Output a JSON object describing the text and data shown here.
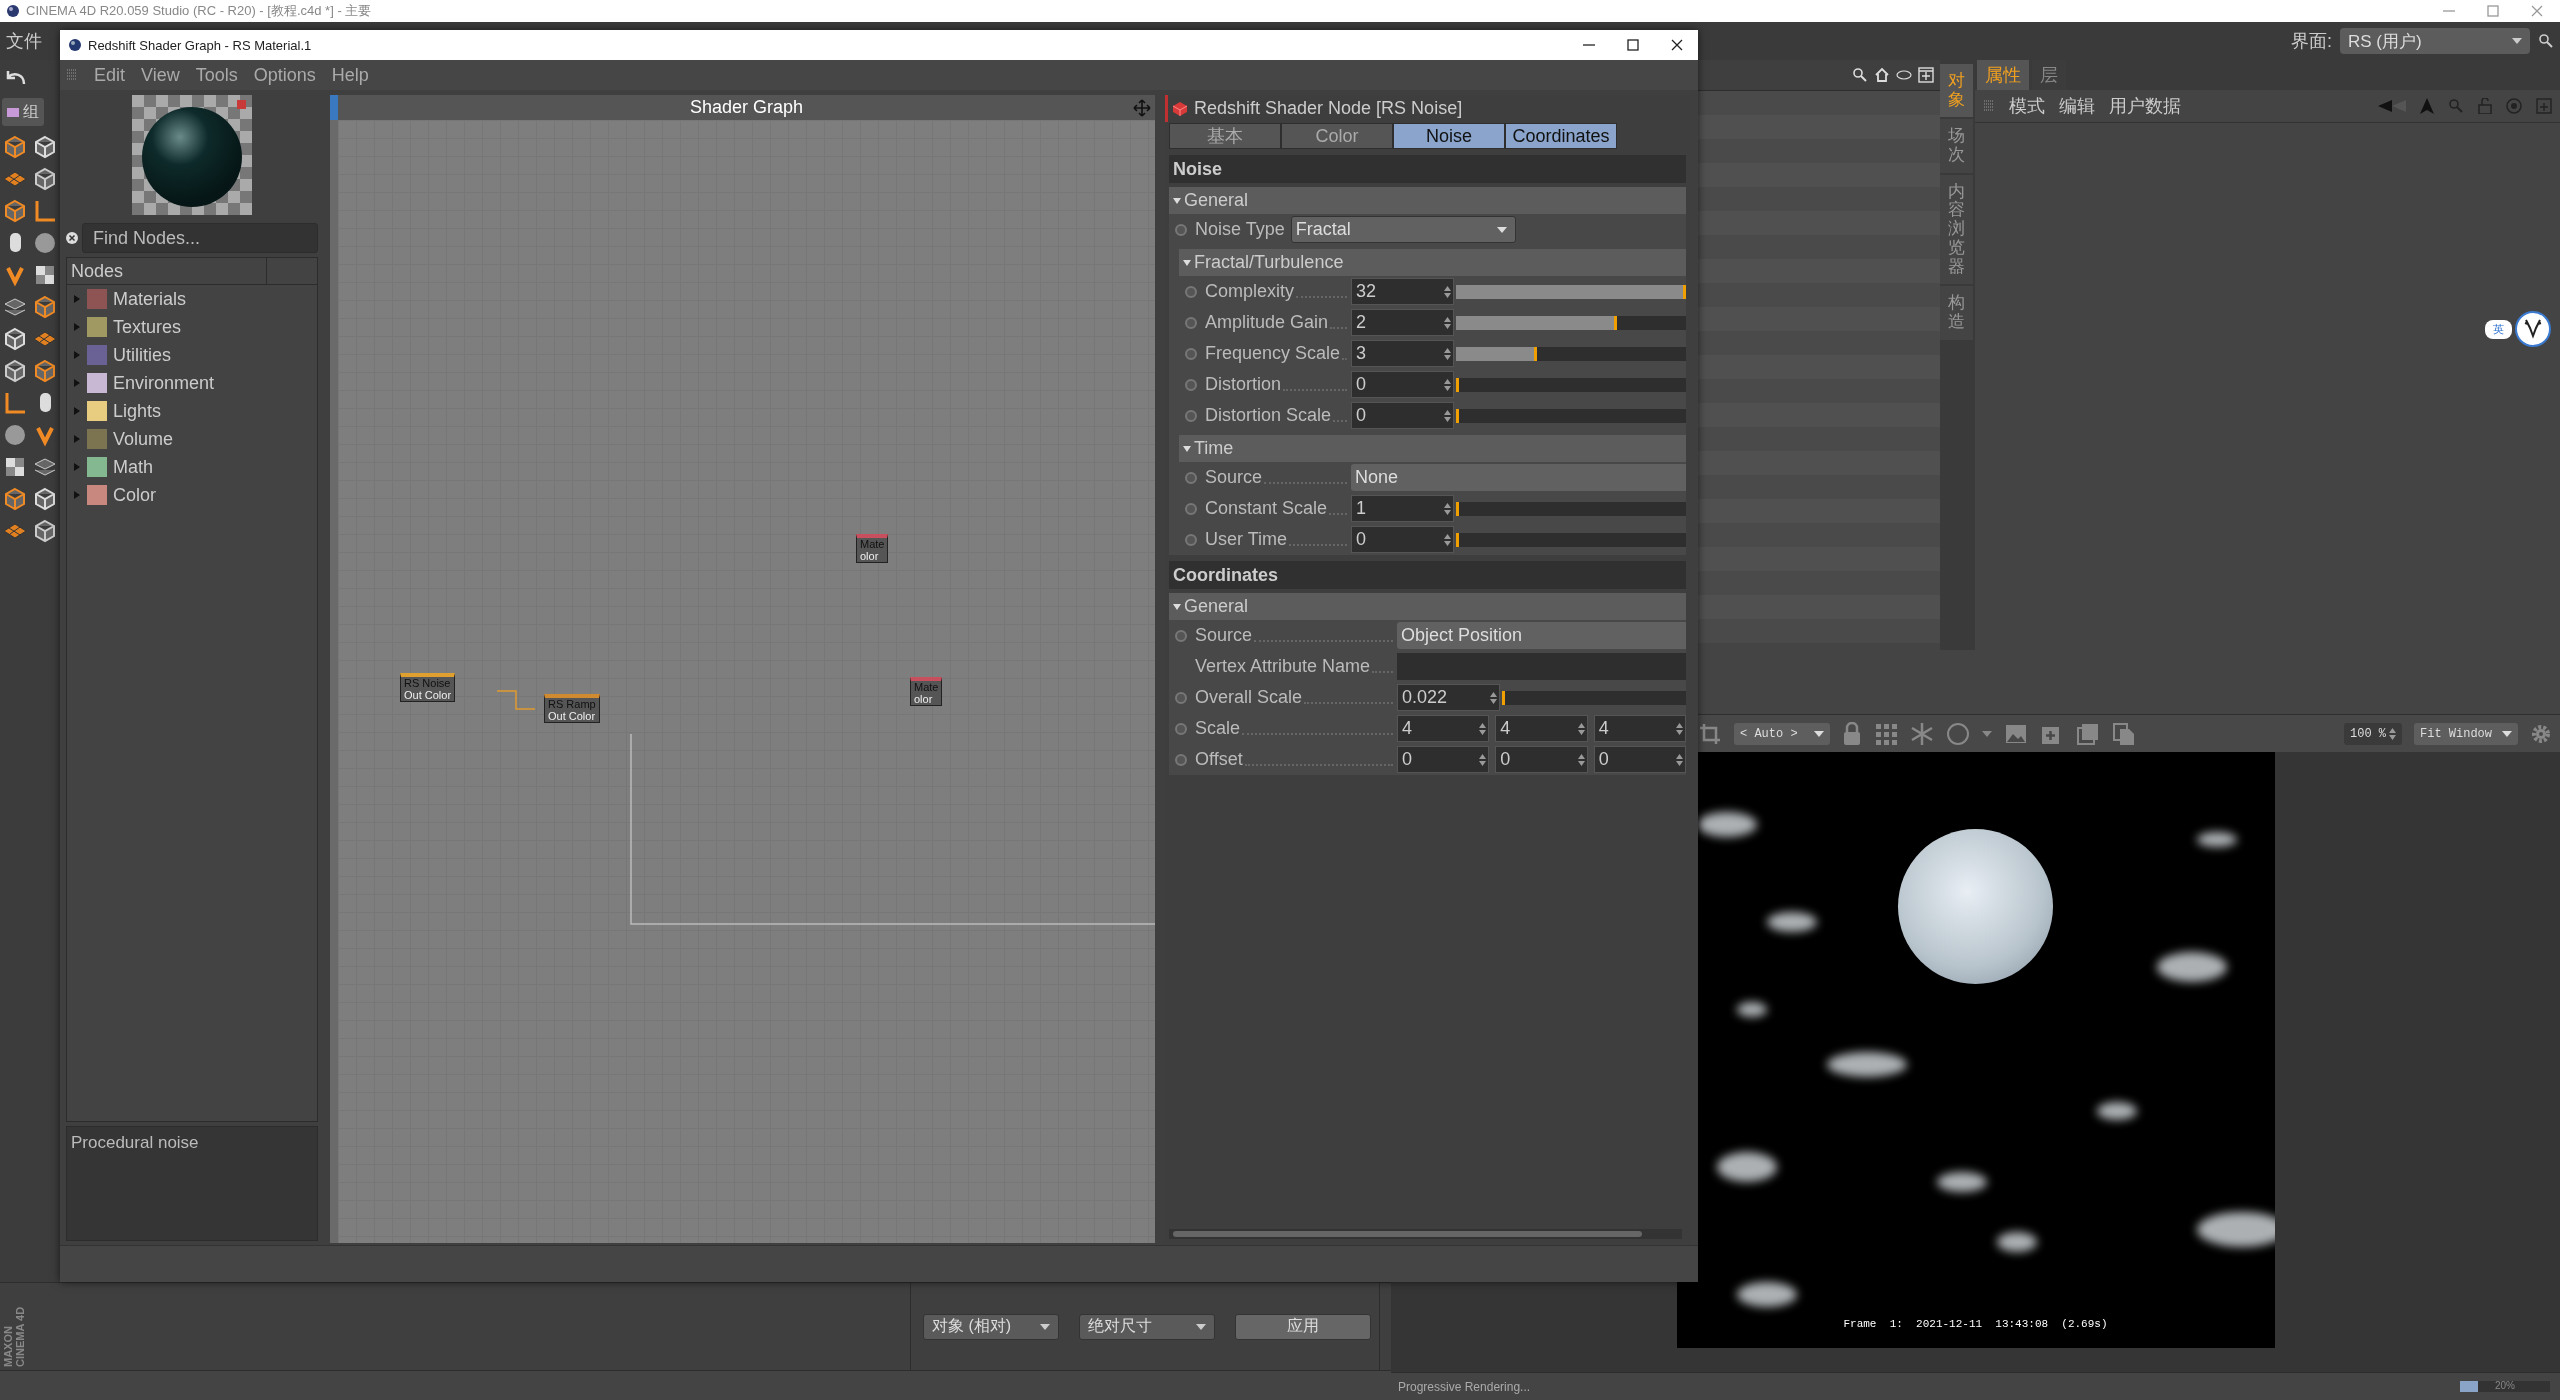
{
  "app_title": "CINEMA 4D R20.059 Studio (RC - R20) - [教程.c4d *] - 主要",
  "main_menu": [
    "文件"
  ],
  "layer_chip": "组",
  "shader_window": {
    "title": "Redshift Shader Graph - RS Material.1",
    "menu": [
      "Edit",
      "View",
      "Tools",
      "Options",
      "Help"
    ],
    "search": {
      "placeholder": "Find Nodes..."
    },
    "node_tree": {
      "header": "Nodes",
      "categories": [
        {
          "label": "Materials",
          "color": "#8e5454",
          "expanded": false
        },
        {
          "label": "Textures",
          "color": "#a09a62",
          "expanded": false
        },
        {
          "label": "Utilities",
          "color": "#6a6294",
          "expanded": false
        },
        {
          "label": "Environment",
          "color": "#c8b8d4",
          "expanded": false
        },
        {
          "label": "Lights",
          "color": "#e8cc80",
          "expanded": false
        },
        {
          "label": "Volume",
          "color": "#7c7450",
          "expanded": false
        },
        {
          "label": "Math",
          "color": "#84b890",
          "expanded": false
        },
        {
          "label": "Color",
          "color": "#c88880",
          "expanded": false
        }
      ]
    },
    "description": "Procedural noise",
    "graph": {
      "title": "Shader Graph",
      "nodes": [
        {
          "title": "Mate",
          "port": "olor",
          "color": "#c8505e"
        },
        {
          "title": "RS Noise",
          "port": "Out Color",
          "color": "#e0a030"
        },
        {
          "title": "RS Ramp",
          "port": "Out Color",
          "color": "#d08a30"
        },
        {
          "title": "Mate",
          "port": "olor",
          "color": "#c8505e"
        }
      ]
    },
    "properties": {
      "title": "Redshift Shader Node [RS Noise]",
      "tabs": [
        {
          "label": "基本",
          "selected": false
        },
        {
          "label": "Color",
          "selected": false
        },
        {
          "label": "Noise",
          "selected": true
        },
        {
          "label": "Coordinates",
          "selected": true
        }
      ],
      "sections": [
        {
          "title": "Noise",
          "groups": [
            {
              "title": "General",
              "expanded": true,
              "rows": [
                {
                  "kind": "dropdown",
                  "label": "Noise Type",
                  "value": "Fractal",
                  "animatable": true
                }
              ],
              "children": [
                {
                  "title": "Fractal/Turbulence",
                  "expanded": true,
                  "rows": [
                    {
                      "kind": "slider",
                      "label": "Complexity",
                      "value": "32",
                      "level": 1,
                      "animatable": true
                    },
                    {
                      "kind": "slider",
                      "label": "Amplitude Gain",
                      "value": "2",
                      "level": 0.7,
                      "animatable": true
                    },
                    {
                      "kind": "slider",
                      "label": "Frequency Scale",
                      "value": "3",
                      "level": 0.35,
                      "animatable": true
                    },
                    {
                      "kind": "slider",
                      "label": "Distortion",
                      "value": "0",
                      "level": 0,
                      "animatable": true
                    },
                    {
                      "kind": "slider",
                      "label": "Distortion Scale",
                      "value": "0",
                      "level": 0,
                      "animatable": true
                    }
                  ]
                },
                {
                  "title": "Time",
                  "expanded": true,
                  "rows": [
                    {
                      "kind": "choice",
                      "label": "Source",
                      "value": "None",
                      "animatable": true
                    },
                    {
                      "kind": "slider",
                      "label": "Constant Scale",
                      "value": "1",
                      "level": 0.01,
                      "animatable": true
                    },
                    {
                      "kind": "slider",
                      "label": "User Time",
                      "value": "0",
                      "level": 0,
                      "animatable": true
                    }
                  ]
                }
              ]
            }
          ]
        },
        {
          "title": "Coordinates",
          "groups": [
            {
              "title": "General",
              "expanded": true,
              "rows": [
                {
                  "kind": "choice",
                  "label": "Source",
                  "value": "Object Position",
                  "animatable": true
                },
                {
                  "kind": "text",
                  "label": "Vertex Attribute Name",
                  "animatable": false
                },
                {
                  "kind": "slider",
                  "label": "Overall Scale",
                  "value": "0.022",
                  "level": 0.01,
                  "animatable": true
                },
                {
                  "kind": "vector",
                  "label": "Scale",
                  "values": [
                    "4",
                    "4",
                    "4"
                  ],
                  "animatable": true
                },
                {
                  "kind": "vector",
                  "label": "Offset",
                  "values": [
                    "0",
                    "0",
                    "0"
                  ],
                  "animatable": true
                }
              ]
            }
          ]
        }
      ]
    }
  },
  "interface": {
    "label": "界面:",
    "value": "RS (用户)"
  },
  "manager_tabs": [
    {
      "label": "对象",
      "selected": true
    },
    {
      "label": "场次",
      "selected": false
    },
    {
      "label": "内容浏览器",
      "selected": false
    },
    {
      "label": "构造",
      "selected": false
    }
  ],
  "attributes": {
    "tabs": [
      {
        "label": "属性",
        "selected": true
      },
      {
        "label": "层",
        "selected": false
      }
    ],
    "menu": [
      "模式",
      "编辑",
      "用户数据"
    ]
  },
  "ime_badge": "英",
  "coordinates": {
    "dropdowns": [
      "对象 (相对)",
      "绝对尺寸"
    ],
    "apply": "应用"
  },
  "logo": "MAXON CINEMA 4D",
  "viewer": {
    "mode": "< Auto >",
    "zoom": "100 %",
    "fit": "Fit Window",
    "frame_info": "Frame  1:  2021-12-11  13:43:08  (2.69s)",
    "status": "Progressive Rendering...",
    "progress": {
      "level": 0.2,
      "reading": "20%"
    }
  }
}
